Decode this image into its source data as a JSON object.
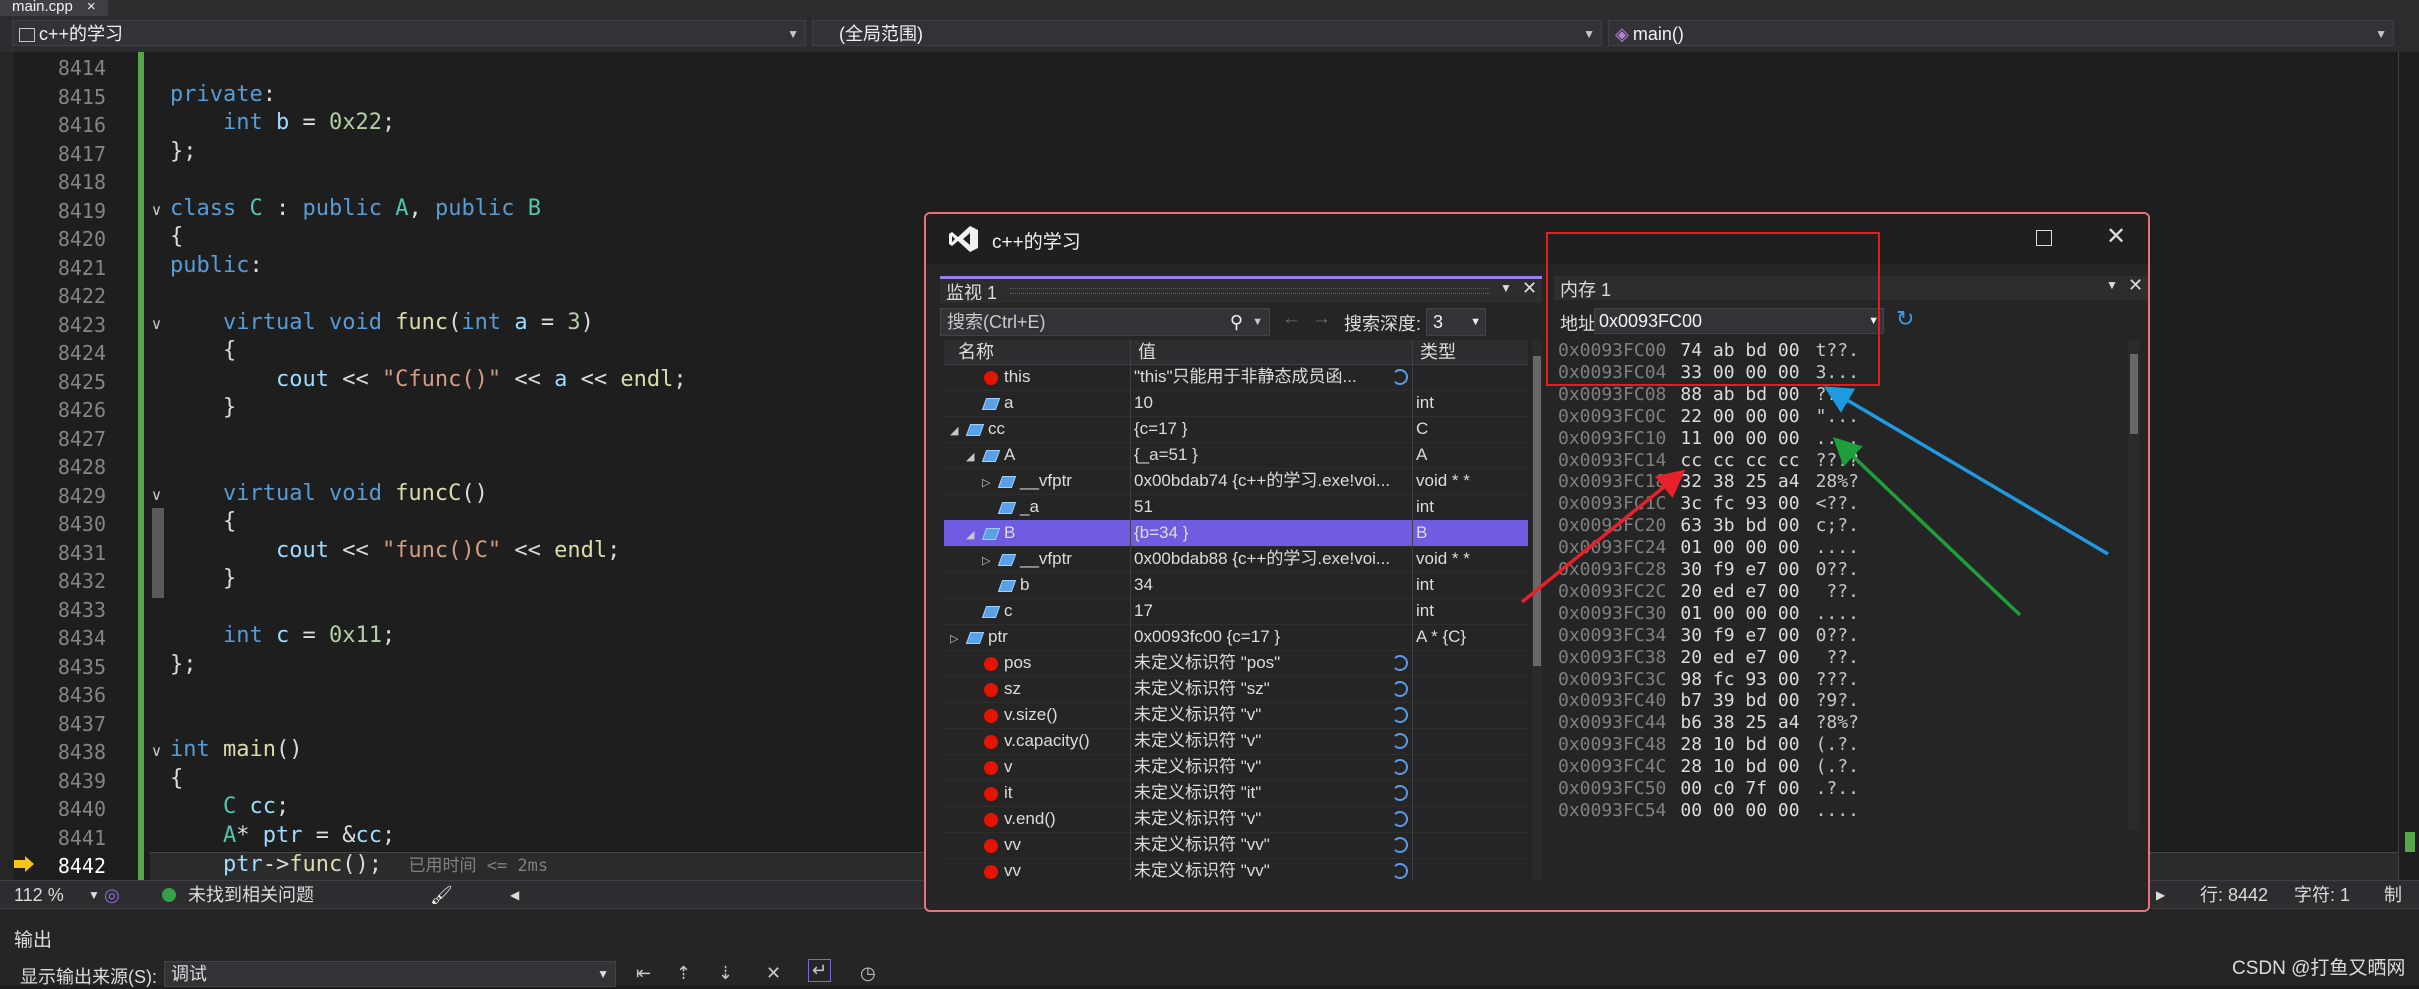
{
  "tab": {
    "file": "main.cpp",
    "close": "×"
  },
  "navbar": {
    "project": "c++的学习",
    "scope": "(全局范围)",
    "member": "main()"
  },
  "editor": {
    "lines": [
      {
        "n": "8414",
        "html": ""
      },
      {
        "n": "8415",
        "html": "<span class=\"kw\">private</span>:"
      },
      {
        "n": "8416",
        "html": "    <span class=\"kw\">int</span> <span class=\"vr\">b</span> = <span class=\"nm\">0x22</span>;"
      },
      {
        "n": "8417",
        "html": "};"
      },
      {
        "n": "8418",
        "html": ""
      },
      {
        "n": "8419",
        "html": "<span class=\"kw\">class</span> <span class=\"ty\">C</span> : <span class=\"kw\">public</span> <span class=\"ty\">A</span>, <span class=\"kw\">public</span> <span class=\"ty\">B</span>"
      },
      {
        "n": "8420",
        "html": "{"
      },
      {
        "n": "8421",
        "html": "<span class=\"kw\">public</span>:"
      },
      {
        "n": "8422",
        "html": ""
      },
      {
        "n": "8423",
        "html": "    <span class=\"kw\">virtual</span> <span class=\"kw\">void</span> <span class=\"fn\">func</span>(<span class=\"kw\">int</span> <span class=\"vr\">a</span> = <span class=\"nm\">3</span>)"
      },
      {
        "n": "8424",
        "html": "    {"
      },
      {
        "n": "8425",
        "html": "        <span class=\"vr\">cout</span> &lt;&lt; <span class=\"st\">\"Cfunc()\"</span> &lt;&lt; <span class=\"vr\">a</span> &lt;&lt; <span class=\"fn\">endl</span>;"
      },
      {
        "n": "8426",
        "html": "    }"
      },
      {
        "n": "8427",
        "html": ""
      },
      {
        "n": "8428",
        "html": ""
      },
      {
        "n": "8429",
        "html": "    <span class=\"kw\">virtual</span> <span class=\"kw\">void</span> <span class=\"fn\">funcC</span>()"
      },
      {
        "n": "8430",
        "html": "    {"
      },
      {
        "n": "8431",
        "html": "        <span class=\"vr\">cout</span> &lt;&lt; <span class=\"st\">\"func()C\"</span> &lt;&lt; <span class=\"fn\">endl</span>;"
      },
      {
        "n": "8432",
        "html": "    }"
      },
      {
        "n": "8433",
        "html": ""
      },
      {
        "n": "8434",
        "html": "    <span class=\"kw\">int</span> <span class=\"vr\">c</span> = <span class=\"nm\">0x11</span>;"
      },
      {
        "n": "8435",
        "html": "};"
      },
      {
        "n": "8436",
        "html": ""
      },
      {
        "n": "8437",
        "html": ""
      },
      {
        "n": "8438",
        "html": "<span class=\"kw\">int</span> <span class=\"fn\">main</span>()"
      },
      {
        "n": "8439",
        "html": "{"
      },
      {
        "n": "8440",
        "html": "    <span class=\"ty\">C</span> <span class=\"vr\">cc</span>;"
      },
      {
        "n": "8441",
        "html": "    <span class=\"ty\">A</span>* <span class=\"vr\">ptr</span> = &amp;<span class=\"vr\">cc</span>;"
      },
      {
        "n": "8442",
        "html": "    <span class=\"vr\">ptr</span>-&gt;<span class=\"fn\">func</span>();  <span style=\"color:#808080;font-size:17px\">已用时间 &lt;= 2ms</span>"
      }
    ]
  },
  "status": {
    "zoom": "112 %",
    "issues": "未找到相关问题",
    "line": "行: 8442",
    "col": "字符: 1",
    "tabs": "制表符"
  },
  "output": {
    "title": "输出",
    "source_label": "显示输出来源(S):",
    "source_value": "调试",
    "watermark": "CSDN @打鱼又晒网"
  },
  "dialog": {
    "title": "c++的学习"
  },
  "watch": {
    "title": "监视 1",
    "search_placeholder": "搜索(Ctrl+E)",
    "depth_label": "搜索深度:",
    "depth_value": "3",
    "col_name": "名称",
    "col_value": "值",
    "col_type": "类型",
    "rows": [
      {
        "indent": 1,
        "exp": "",
        "icon": "err",
        "name": "this",
        "value": "\"this\"只能用于非静态成员函...",
        "type": "",
        "refresh": true
      },
      {
        "indent": 1,
        "exp": "",
        "icon": "obj",
        "name": "a",
        "value": "10",
        "type": "int"
      },
      {
        "indent": 0,
        "exp": "◢",
        "icon": "obj",
        "name": "cc",
        "value": "{c=17 }",
        "type": "C"
      },
      {
        "indent": 1,
        "exp": "◢",
        "icon": "obj",
        "name": "A",
        "value": "{_a=51 }",
        "type": "A"
      },
      {
        "indent": 2,
        "exp": "▷",
        "icon": "obj",
        "name": "__vfptr",
        "value": "0x00bdab74 {c++的学习.exe!voi...",
        "type": "void * *"
      },
      {
        "indent": 2,
        "exp": "",
        "icon": "obj",
        "name": "_a",
        "value": "51",
        "type": "int"
      },
      {
        "indent": 1,
        "exp": "◢",
        "icon": "obj",
        "name": "B",
        "value": "{b=34 }",
        "type": "B",
        "selected": true
      },
      {
        "indent": 2,
        "exp": "▷",
        "icon": "obj",
        "name": "__vfptr",
        "value": "0x00bdab88 {c++的学习.exe!voi...",
        "type": "void * *"
      },
      {
        "indent": 2,
        "exp": "",
        "icon": "obj",
        "name": "b",
        "value": "34",
        "type": "int"
      },
      {
        "indent": 1,
        "exp": "",
        "icon": "obj",
        "name": "c",
        "value": "17",
        "type": "int"
      },
      {
        "indent": 0,
        "exp": "▷",
        "icon": "obj",
        "name": "ptr",
        "value": "0x0093fc00 {c=17 }",
        "type": "A * {C}"
      },
      {
        "indent": 1,
        "exp": "",
        "icon": "err",
        "name": "pos",
        "value": "未定义标识符 \"pos\"",
        "type": "",
        "refresh": true
      },
      {
        "indent": 1,
        "exp": "",
        "icon": "err",
        "name": "sz",
        "value": "未定义标识符 \"sz\"",
        "type": "",
        "refresh": true
      },
      {
        "indent": 1,
        "exp": "",
        "icon": "err",
        "name": "v.size()",
        "value": "未定义标识符 \"v\"",
        "type": "",
        "refresh": true
      },
      {
        "indent": 1,
        "exp": "",
        "icon": "err",
        "name": "v.capacity()",
        "value": "未定义标识符 \"v\"",
        "type": "",
        "refresh": true
      },
      {
        "indent": 1,
        "exp": "",
        "icon": "err",
        "name": "v",
        "value": "未定义标识符 \"v\"",
        "type": "",
        "refresh": true
      },
      {
        "indent": 1,
        "exp": "",
        "icon": "err",
        "name": "it",
        "value": "未定义标识符 \"it\"",
        "type": "",
        "refresh": true
      },
      {
        "indent": 1,
        "exp": "",
        "icon": "err",
        "name": "v.end()",
        "value": "未定义标识符 \"v\"",
        "type": "",
        "refresh": true
      },
      {
        "indent": 1,
        "exp": "",
        "icon": "err",
        "name": "vv",
        "value": "未定义标识符 \"vv\"",
        "type": "",
        "refresh": true
      },
      {
        "indent": 1,
        "exp": "",
        "icon": "err",
        "name": "vv",
        "value": "未定义标识符 \"vv\"",
        "type": "",
        "refresh": true
      }
    ]
  },
  "memory": {
    "title": "内存 1",
    "addr_label": "地址:",
    "addr_value": "0x0093FC00",
    "rows": [
      {
        "addr": "0x0093FC00",
        "hex": "74 ab bd 00",
        "chr": "t??."
      },
      {
        "addr": "0x0093FC04",
        "hex": "33 00 00 00",
        "chr": "3..."
      },
      {
        "addr": "0x0093FC08",
        "hex": "88 ab bd 00",
        "chr": "??."
      },
      {
        "addr": "0x0093FC0C",
        "hex": "22 00 00 00",
        "chr": "\"..."
      },
      {
        "addr": "0x0093FC10",
        "hex": "11 00 00 00",
        "chr": "...."
      },
      {
        "addr": "0x0093FC14",
        "hex": "cc cc cc cc",
        "chr": "????"
      },
      {
        "addr": "0x0093FC18",
        "hex": "32 38 25 a4",
        "chr": "28%?"
      },
      {
        "addr": "0x0093FC1C",
        "hex": "3c fc 93 00",
        "chr": "<??."
      },
      {
        "addr": "0x0093FC20",
        "hex": "63 3b bd 00",
        "chr": "c;?."
      },
      {
        "addr": "0x0093FC24",
        "hex": "01 00 00 00",
        "chr": "...."
      },
      {
        "addr": "0x0093FC28",
        "hex": "30 f9 e7 00",
        "chr": "0??."
      },
      {
        "addr": "0x0093FC2C",
        "hex": "20 ed e7 00",
        "chr": " ??."
      },
      {
        "addr": "0x0093FC30",
        "hex": "01 00 00 00",
        "chr": "...."
      },
      {
        "addr": "0x0093FC34",
        "hex": "30 f9 e7 00",
        "chr": "0??."
      },
      {
        "addr": "0x0093FC38",
        "hex": "20 ed e7 00",
        "chr": " ??."
      },
      {
        "addr": "0x0093FC3C",
        "hex": "98 fc 93 00",
        "chr": "???."
      },
      {
        "addr": "0x0093FC40",
        "hex": "b7 39 bd 00",
        "chr": "?9?."
      },
      {
        "addr": "0x0093FC44",
        "hex": "b6 38 25 a4",
        "chr": "?8%?"
      },
      {
        "addr": "0x0093FC48",
        "hex": "28 10 bd 00",
        "chr": "(.?."
      },
      {
        "addr": "0x0093FC4C",
        "hex": "28 10 bd 00",
        "chr": "(.?."
      },
      {
        "addr": "0x0093FC50",
        "hex": "00 c0 7f 00",
        "chr": ".?.."
      },
      {
        "addr": "0x0093FC54",
        "hex": "00 00 00 00",
        "chr": "...."
      }
    ]
  },
  "colors": {
    "red_arrow": "#e8202a",
    "green_arrow": "#1e9e3a",
    "blue_arrow": "#1e9be0",
    "highlight_box": "#e02020",
    "selection": "#6f5ce0"
  }
}
